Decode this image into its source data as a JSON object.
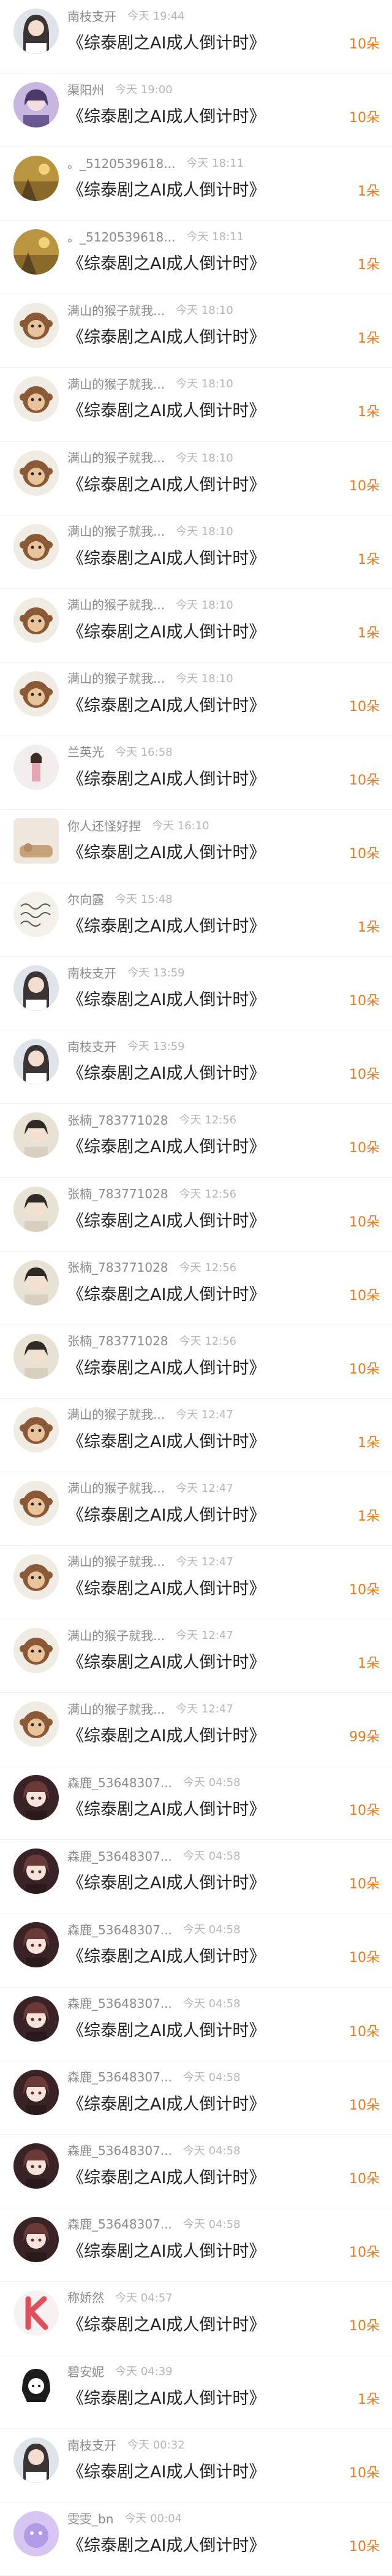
{
  "rows": [
    {
      "name": "南枝支开",
      "time": "今天 19:44",
      "title": "《综泰剧之AI成人倒计时》",
      "count": "10朵",
      "avatar": "girl-dark-hair"
    },
    {
      "name": "渠阳州",
      "time": "今天 19:00",
      "title": "《综泰剧之AI成人倒计时》",
      "count": "10朵",
      "avatar": "purple-portrait"
    },
    {
      "name": "。_5120539618...",
      "time": "今天 18:11",
      "title": "《综泰剧之AI成人倒计时》",
      "count": "1朵",
      "avatar": "golden-scene"
    },
    {
      "name": "。_5120539618...",
      "time": "今天 18:11",
      "title": "《综泰剧之AI成人倒计时》",
      "count": "1朵",
      "avatar": "golden-scene"
    },
    {
      "name": "满山的猴子就我...",
      "time": "今天 18:10",
      "title": "《综泰剧之AI成人倒计时》",
      "count": "1朵",
      "avatar": "monkey"
    },
    {
      "name": "满山的猴子就我...",
      "time": "今天 18:10",
      "title": "《综泰剧之AI成人倒计时》",
      "count": "1朵",
      "avatar": "monkey"
    },
    {
      "name": "满山的猴子就我...",
      "time": "今天 18:10",
      "title": "《综泰剧之AI成人倒计时》",
      "count": "10朵",
      "avatar": "monkey"
    },
    {
      "name": "满山的猴子就我...",
      "time": "今天 18:10",
      "title": "《综泰剧之AI成人倒计时》",
      "count": "1朵",
      "avatar": "monkey"
    },
    {
      "name": "满山的猴子就我...",
      "time": "今天 18:10",
      "title": "《综泰剧之AI成人倒计时》",
      "count": "1朵",
      "avatar": "monkey"
    },
    {
      "name": "满山的猴子就我...",
      "time": "今天 18:10",
      "title": "《综泰剧之AI成人倒计时》",
      "count": "10朵",
      "avatar": "monkey"
    },
    {
      "name": "兰英光",
      "time": "今天 16:58",
      "title": "《综泰剧之AI成人倒计时》",
      "count": "10朵",
      "avatar": "girl-standing"
    },
    {
      "name": "你人还怪好捏",
      "time": "今天 16:10",
      "title": "《综泰剧之AI成人倒计时》",
      "count": "10朵",
      "avatar": "cat-square"
    },
    {
      "name": "尔向露",
      "time": "今天 15:48",
      "title": "《综泰剧之AI成人倒计时》",
      "count": "1朵",
      "avatar": "handwriting"
    },
    {
      "name": "南枝支开",
      "time": "今天 13:59",
      "title": "《综泰剧之AI成人倒计时》",
      "count": "10朵",
      "avatar": "girl-dark-hair"
    },
    {
      "name": "南枝支开",
      "time": "今天 13:59",
      "title": "《综泰剧之AI成人倒计时》",
      "count": "10朵",
      "avatar": "girl-dark-hair"
    },
    {
      "name": "张楠_783771028",
      "time": "今天 12:56",
      "title": "《综泰剧之AI成人倒计时》",
      "count": "10朵",
      "avatar": "pale-portrait"
    },
    {
      "name": "张楠_783771028",
      "time": "今天 12:56",
      "title": "《综泰剧之AI成人倒计时》",
      "count": "10朵",
      "avatar": "pale-portrait"
    },
    {
      "name": "张楠_783771028",
      "time": "今天 12:56",
      "title": "《综泰剧之AI成人倒计时》",
      "count": "10朵",
      "avatar": "pale-portrait"
    },
    {
      "name": "张楠_783771028",
      "time": "今天 12:56",
      "title": "《综泰剧之AI成人倒计时》",
      "count": "10朵",
      "avatar": "pale-portrait"
    },
    {
      "name": "满山的猴子就我...",
      "time": "今天 12:47",
      "title": "《综泰剧之AI成人倒计时》",
      "count": "1朵",
      "avatar": "monkey"
    },
    {
      "name": "满山的猴子就我...",
      "time": "今天 12:47",
      "title": "《综泰剧之AI成人倒计时》",
      "count": "1朵",
      "avatar": "monkey"
    },
    {
      "name": "满山的猴子就我...",
      "time": "今天 12:47",
      "title": "《综泰剧之AI成人倒计时》",
      "count": "10朵",
      "avatar": "monkey"
    },
    {
      "name": "满山的猴子就我...",
      "time": "今天 12:47",
      "title": "《综泰剧之AI成人倒计时》",
      "count": "1朵",
      "avatar": "monkey"
    },
    {
      "name": "满山的猴子就我...",
      "time": "今天 12:47",
      "title": "《综泰剧之AI成人倒计时》",
      "count": "99朵",
      "avatar": "monkey"
    },
    {
      "name": "森鹿_53648307...",
      "time": "今天 04:58",
      "title": "《综泰剧之AI成人倒计时》",
      "count": "10朵",
      "avatar": "anime-girl"
    },
    {
      "name": "森鹿_53648307...",
      "time": "今天 04:58",
      "title": "《综泰剧之AI成人倒计时》",
      "count": "10朵",
      "avatar": "anime-girl"
    },
    {
      "name": "森鹿_53648307...",
      "time": "今天 04:58",
      "title": "《综泰剧之AI成人倒计时》",
      "count": "10朵",
      "avatar": "anime-girl"
    },
    {
      "name": "森鹿_53648307...",
      "time": "今天 04:58",
      "title": "《综泰剧之AI成人倒计时》",
      "count": "10朵",
      "avatar": "anime-girl"
    },
    {
      "name": "森鹿_53648307...",
      "time": "今天 04:58",
      "title": "《综泰剧之AI成人倒计时》",
      "count": "10朵",
      "avatar": "anime-girl"
    },
    {
      "name": "森鹿_53648307...",
      "time": "今天 04:58",
      "title": "《综泰剧之AI成人倒计时》",
      "count": "10朵",
      "avatar": "anime-girl"
    },
    {
      "name": "森鹿_53648307...",
      "time": "今天 04:58",
      "title": "《综泰剧之AI成人倒计时》",
      "count": "10朵",
      "avatar": "anime-girl"
    },
    {
      "name": "称娇然",
      "time": "今天 04:57",
      "title": "《综泰剧之AI成人倒计时》",
      "count": "10朵",
      "avatar": "letter-k"
    },
    {
      "name": "碧安妮",
      "time": "今天 04:39",
      "title": "《综泰剧之AI成人倒计时》",
      "count": "1朵",
      "avatar": "sketch-girl"
    },
    {
      "name": "南枝支开",
      "time": "今天 00:32",
      "title": "《综泰剧之AI成人倒计时》",
      "count": "10朵",
      "avatar": "girl-dark-hair"
    },
    {
      "name": "雯雯_bn",
      "time": "今天 00:04",
      "title": "《综泰剧之AI成人倒计时》",
      "count": "10朵",
      "avatar": "purple-blob"
    }
  ]
}
